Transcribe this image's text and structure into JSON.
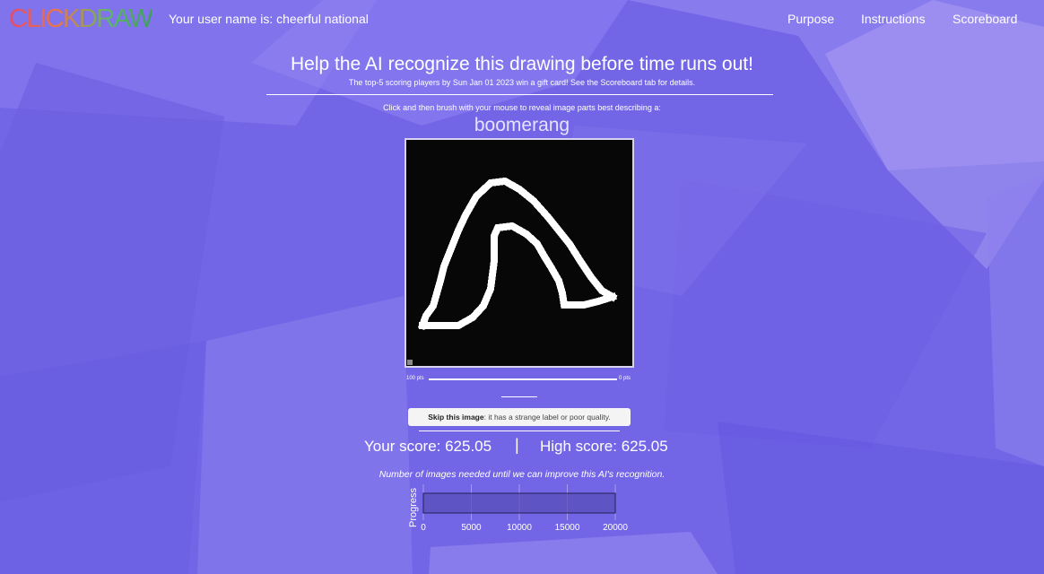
{
  "header": {
    "logo": "CLICKDRAW",
    "username_text": "Your user name is: cheerful national",
    "nav": [
      "Purpose",
      "Instructions",
      "Scoreboard"
    ]
  },
  "main": {
    "headline": "Help the AI recognize this drawing before time runs out!",
    "subnote": "The top-5 scoring players by Sun Jan 01 2023 win a gift card! See the Scoreboard tab for details.",
    "instruction": "Click and then brush with your mouse to reveal image parts best describing a:",
    "target_word": "boomerang",
    "points_left": "100 pts",
    "points_right": "0 pts",
    "skip_bold": "Skip this image",
    "skip_rest": ": it has a strange label or poor quality.",
    "your_score": "Your score: 625.05",
    "separator": "|",
    "high_score": "High score: 625.05"
  },
  "progress": {
    "caption": "Number of images needed until we can improve this AI's recognition.",
    "ylabel": "Progress",
    "ticks": [
      "0",
      "5000",
      "10000",
      "15000",
      "20000"
    ]
  },
  "chart_data": {
    "type": "bar",
    "orientation": "horizontal",
    "ylabel": "Progress",
    "xlim": [
      0,
      20000
    ],
    "values": [
      20000
    ],
    "grid": true
  },
  "colors": {
    "background": "#7a6ee8",
    "canvas": "#070707",
    "bar_fill": "#5a4fb8"
  }
}
